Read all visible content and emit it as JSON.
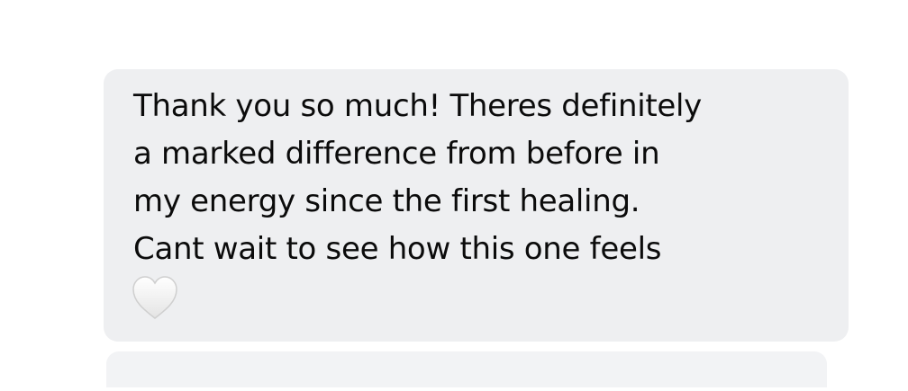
{
  "message": {
    "text": "Thank you so much! Theres definitely\na marked difference from before in\nmy energy since the first healing.\nCant wait to see how this one feels",
    "emoji": "white-heart-icon"
  },
  "colors": {
    "bubble_background": "#eeeff1",
    "text": "#0b0b0b",
    "page_background": "#ffffff"
  }
}
